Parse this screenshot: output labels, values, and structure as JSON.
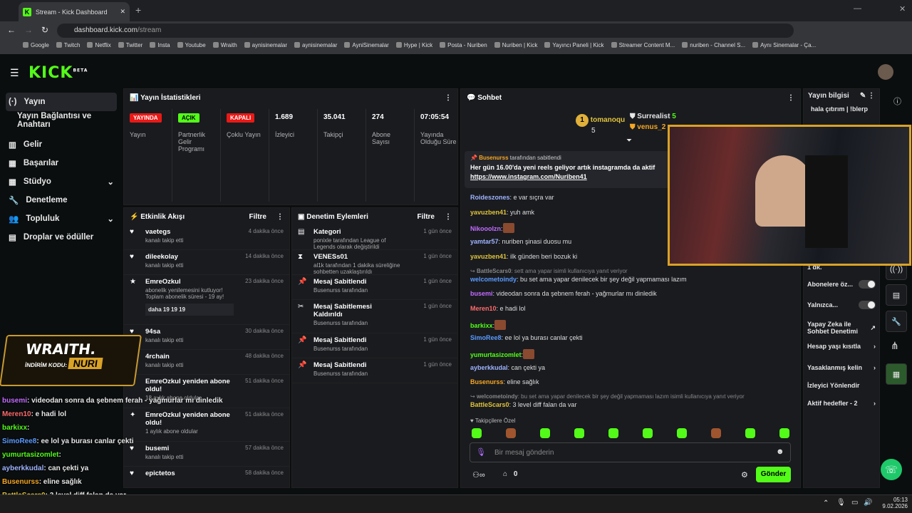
{
  "browser": {
    "tab_title": "Stream - Kick Dashboard",
    "url_host": "dashboard.kick.com",
    "url_path": "/stream",
    "bookmarks": [
      "Google",
      "Twitch",
      "Netflix",
      "Twitter",
      "Insta",
      "Youtube",
      "Wraith",
      "aynisinemalar",
      "aynisinemalar",
      "AyniSinemalar",
      "Hype | Kick",
      "Posta - Nuriben",
      "Nuriben | Kick",
      "Yayıncı Paneli | Kick",
      "Streamer Content M...",
      "nuriben - Channel S...",
      "Aynı Sinemalar - Ça..."
    ]
  },
  "brand": {
    "logo": "KICK",
    "beta": "BETA",
    "accent": "#53fc18"
  },
  "sidebar": {
    "items": [
      {
        "label": "Yayın",
        "icon": "broadcast-icon"
      },
      {
        "label": "Yayın Bağlantısı ve Anahtarı",
        "icon": ""
      },
      {
        "label": "Gelir",
        "icon": "revenue-icon"
      },
      {
        "label": "Başarılar",
        "icon": "achievement-icon"
      },
      {
        "label": "Stüdyo",
        "icon": "studio-icon"
      },
      {
        "label": "Denetleme",
        "icon": "wrench-icon"
      },
      {
        "label": "Topluluk",
        "icon": "community-icon"
      },
      {
        "label": "Droplar ve ödüller",
        "icon": "drops-icon"
      }
    ]
  },
  "stats": {
    "title": "Yayın İstatistikleri",
    "badges": [
      {
        "text": "YAYINDA",
        "label": "Yayın",
        "color": "#e91916"
      },
      {
        "text": "AÇIK",
        "label": "Partnerlik Gelir Programı",
        "color": "#53fc18"
      },
      {
        "text": "KAPALI",
        "label": "Çoklu Yayın",
        "color": "#e91916"
      }
    ],
    "values": [
      {
        "v": "1.689",
        "label": "İzleyici"
      },
      {
        "v": "35.041",
        "label": "Takipçi"
      },
      {
        "v": "274",
        "label": "Abone Sayısı"
      },
      {
        "v": "07:05:54",
        "label": "Yayında Olduğu Süre"
      }
    ]
  },
  "activity": {
    "title": "Etkinlik Akışı",
    "filter": "Filtre",
    "items": [
      {
        "name": "vaetegs",
        "desc": "kanalı takip etti",
        "time": "4 dakika önce",
        "icon": "♥"
      },
      {
        "name": "dileekolay",
        "desc": "kanalı takip etti",
        "time": "14 dakika önce",
        "icon": "♥"
      },
      {
        "name": "EmreOzkul",
        "desc": "abonelik yenilemesini kutluyor! Toplam abonelik süresi - 19 ay!",
        "time": "23 dakika önce",
        "icon": "★",
        "msg": "daha 19 19 19"
      },
      {
        "name": "94sa",
        "desc": "kanalı takip etti",
        "time": "30 dakika önce",
        "icon": "♥"
      },
      {
        "name": "4rchain",
        "desc": "kanalı takip etti",
        "time": "48 dakika önce",
        "icon": "♥"
      },
      {
        "name": "EmreOzkul yeniden abone oldu!",
        "desc": "18 aylık abone oldular",
        "time": "51 dakika önce",
        "icon": "✦"
      },
      {
        "name": "EmreOzkul yeniden abone oldu!",
        "desc": "1 aylık abone oldular",
        "time": "51 dakika önce",
        "icon": "✦"
      },
      {
        "name": "busemi",
        "desc": "kanalı takip etti",
        "time": "57 dakika önce",
        "icon": "♥"
      },
      {
        "name": "epictetos",
        "desc": "",
        "time": "58 dakika önce",
        "icon": "♥"
      }
    ]
  },
  "moderation": {
    "title": "Denetim Eylemleri",
    "filter": "Filtre",
    "items": [
      {
        "name": "Kategori",
        "desc": "ponixle tarafından League of Legends olarak değiştirildi",
        "time": "1 gün önce",
        "icon": "▤"
      },
      {
        "name": "VENESs01",
        "desc": "al1k tarafından 1 dakika süreliğine sohbetten uzaklaştırıldı",
        "time": "1 gün önce",
        "icon": "⧗"
      },
      {
        "name": "Mesaj Sabitlendi",
        "desc": "Busenurss tarafından",
        "time": "1 gün önce",
        "icon": "📌"
      },
      {
        "name": "Mesaj Sabitlemesi Kaldırıldı",
        "desc": "Busenurss tarafından",
        "time": "1 gün önce",
        "icon": "✂"
      },
      {
        "name": "Mesaj Sabitlendi",
        "desc": "Busenurss tarafından",
        "time": "1 gün önce",
        "icon": "📌"
      },
      {
        "name": "Mesaj Sabitlendi",
        "desc": "Busenurss tarafından",
        "time": "1 gün önce",
        "icon": "📌"
      }
    ]
  },
  "chat": {
    "title": "Sohbet",
    "top_gifters": [
      {
        "rank": "1",
        "name": "tomanoqu",
        "count": "5"
      },
      {
        "rank": "",
        "name": "Surrealist",
        "count": "5"
      },
      {
        "rank": "",
        "name": "venus_2",
        "count": ""
      }
    ],
    "pinned": {
      "by": "Busenurss",
      "by_suffix": "tarafından sabitlendi",
      "text": "Her gün 16.00'da yeni reels geliyor artık instagramda da aktif",
      "link": "https://www.instagram.com/Nuriben41"
    },
    "messages": [
      {
        "user": "Roideszones",
        "color": "#9fb4ff",
        "text": ": e var sıçra var"
      },
      {
        "user": "yavuzben41",
        "color": "#e0c33c",
        "text": ": yuh amk"
      },
      {
        "user": "Nikooolzn",
        "color": "#c36bff",
        "text": ":"
      },
      {
        "user": "yamtar57",
        "color": "#9fb4ff",
        "text": ": nuriben şinasi duosu mu"
      },
      {
        "user": "yavuzben41",
        "color": "#e0c33c",
        "text": ": ilk günden beri bozuk ki"
      },
      {
        "user": "BattleScars0",
        "color": "#888",
        "text": ": sett ama yapar isimli kullanıcıya yanıt veriyor",
        "reply": true
      },
      {
        "user": "welcometoindy",
        "color": "#5b9bff",
        "text": ": bu set ama yapar denilecek bir şey değil yapmaması lazım"
      },
      {
        "user": "busemi",
        "color": "#c36bff",
        "text": ": videodan sonra da şebnem ferah - yağmurlar mı dinledik"
      },
      {
        "user": "Meren10",
        "color": "#ff6b6b",
        "text": ": e hadi lol"
      },
      {
        "user": "barkixx",
        "color": "#53fc18",
        "text": ":"
      },
      {
        "user": "SimoRee8",
        "color": "#5b9bff",
        "text": ": ee lol ya burası canlar çekti"
      },
      {
        "user": "yumurtasizomlet",
        "color": "#53fc18",
        "text": ":"
      },
      {
        "user": "ayberkkudal",
        "color": "#9fb4ff",
        "text": ": can çekti ya"
      },
      {
        "user": "Busenurss",
        "color": "#f6a623",
        "text": ": eline sağlık"
      },
      {
        "user": "welcometoindy",
        "color": "#888",
        "text": ": bu set ama yapar denilecek bir şey değil yapmaması lazım isimli kullanıcıya yanıt veriyor",
        "reply": true
      },
      {
        "user": "BattleScars0",
        "color": "#e0c33c",
        "text": ": 3 level diff falan da var"
      }
    ],
    "followers_only": "Takipçilere Özel",
    "placeholder": "Bir mesaj gönderin",
    "send": "Gönder",
    "points": "0"
  },
  "info": {
    "title": "Yayın bilgisi",
    "stream_title": "hala çıtırım | !blerp",
    "rows": [
      "Abonelere öz...",
      "Yalnızca...",
      "Yapay Zeka ile Sohbet Denetimi",
      "Hesap yaşı kısıtla",
      "Yasaklanmış kelin",
      "İzleyici Yönlendir",
      "Aktif hedefler - 2"
    ],
    "slow": "1 dk."
  },
  "overlay": {
    "brand": "WRAITH.",
    "code_label": "İNDİRİM KODU:",
    "code": "NURI",
    "lines": [
      {
        "user": "busemi",
        "color": "#c36bff",
        "text": ": videodan sonra da şebnem ferah - yağmurlar mı dinledik"
      },
      {
        "user": "Meren10",
        "color": "#ff6b6b",
        "text": ": e hadi lol"
      },
      {
        "user": "barkixx",
        "color": "#53fc18",
        "text": ":"
      },
      {
        "user": "SimoRee8",
        "color": "#5b9bff",
        "text": ": ee lol ya burası canlar çekti"
      },
      {
        "user": "yumurtasizomlet",
        "color": "#53fc18",
        "text": ":"
      },
      {
        "user": "ayberkkudal",
        "color": "#9fb4ff",
        "text": ": can çekti ya"
      },
      {
        "user": "Busenurss",
        "color": "#f6a623",
        "text": ": eline sağlık"
      },
      {
        "user": "BattleScars0",
        "color": "#e0c33c",
        "text": ": 3 level diff falan da var"
      }
    ]
  },
  "taskbar": {
    "time": "05:13",
    "date": "9.02.2026"
  }
}
